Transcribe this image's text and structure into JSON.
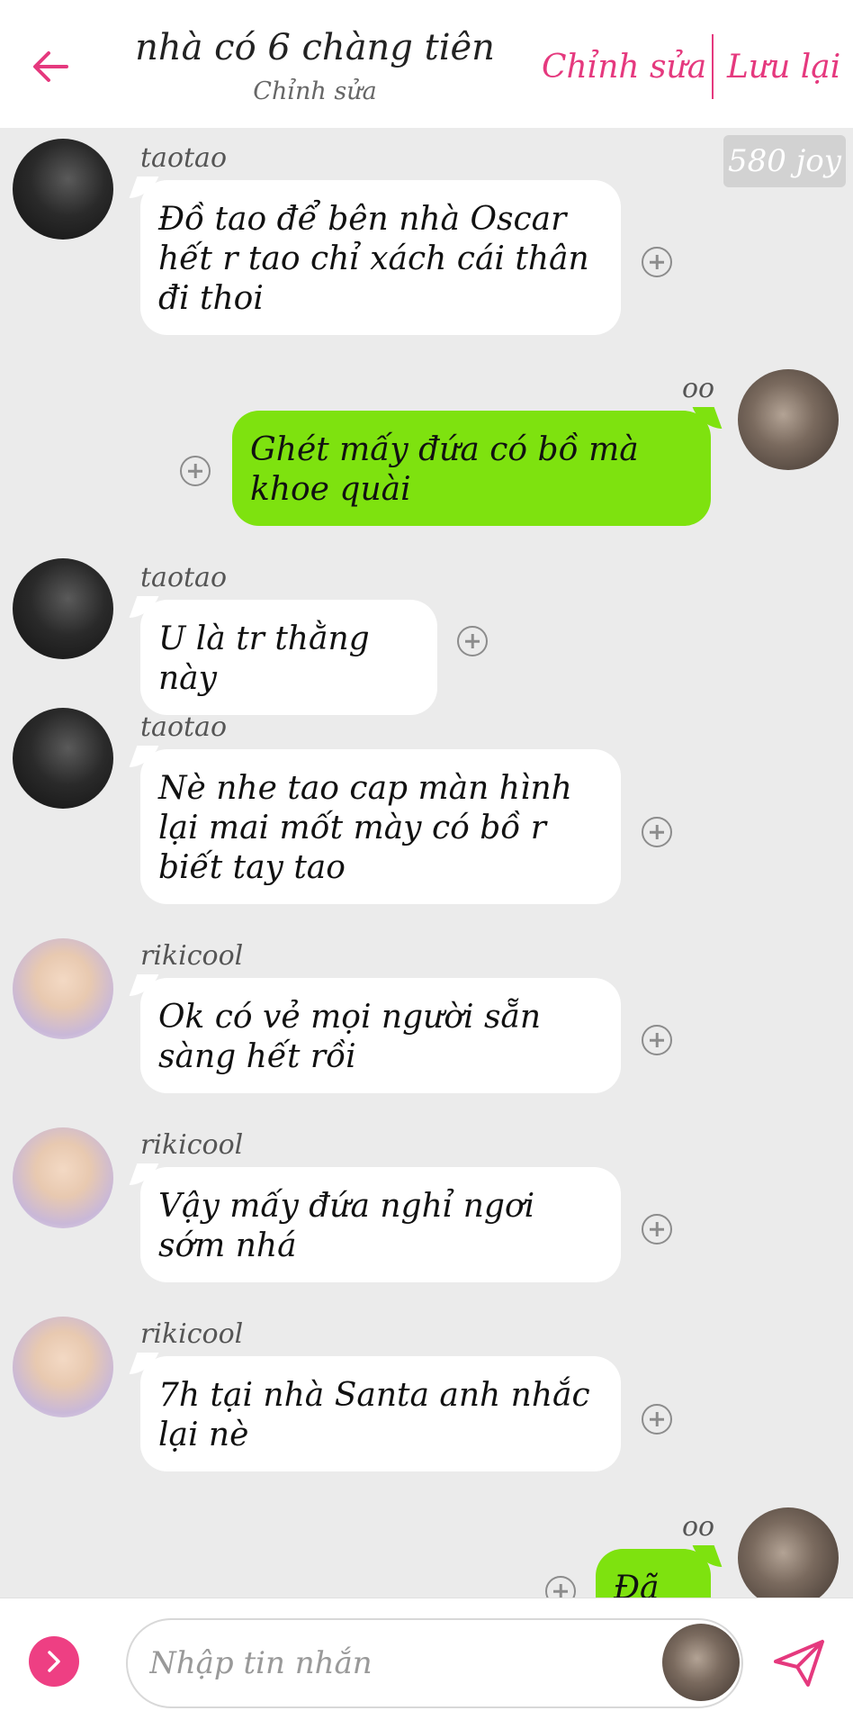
{
  "header": {
    "title": "nhà có 6 chàng tiên",
    "subtitle": "Chỉnh sửa",
    "edit_label": "Chỉnh sửa",
    "save_label": "Lưu lại",
    "back_icon": "arrow-left-icon",
    "accent_color": "#e5397e"
  },
  "chat": {
    "joy_badge": "580 joy",
    "messages": [
      {
        "sender": "taotao",
        "side": "left",
        "avatar": "taotao",
        "text": "Đồ tao để bên nhà Oscar hết r tao chỉ xách cái thân đi thoi"
      },
      {
        "sender": "oo",
        "side": "right",
        "avatar": "oo",
        "text": "Ghét mấy đứa có bồ mà khoe quài"
      },
      {
        "sender": "taotao",
        "side": "left",
        "avatar": "taotao",
        "text": "U là tr thằng này"
      },
      {
        "sender": "taotao",
        "side": "left",
        "avatar": "taotao",
        "text": "Nè nhe tao cap màn hình lại mai mốt mày có bồ r biết tay tao"
      },
      {
        "sender": "rikicool",
        "side": "left",
        "avatar": "rikicool",
        "text": "Ok có vẻ mọi người sẵn sàng hết rồi"
      },
      {
        "sender": "rikicool",
        "side": "left",
        "avatar": "rikicool",
        "text": "Vậy mấy đứa nghỉ ngơi sớm nhá"
      },
      {
        "sender": "rikicool",
        "side": "left",
        "avatar": "rikicool",
        "text": "7h tại nhà Santa anh nhắc lại nè"
      },
      {
        "sender": "oo",
        "side": "right",
        "avatar": "oo",
        "text": "Đã rõ"
      }
    ],
    "bubble_colors": {
      "left": "#ffffff",
      "right": "#7ee20f"
    }
  },
  "footer": {
    "placeholder": "Nhập tin nhắn",
    "expand_icon": "chevron-right-icon",
    "send_icon": "paper-plane-icon"
  }
}
